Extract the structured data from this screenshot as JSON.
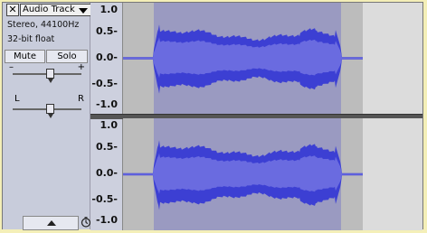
{
  "track": {
    "name": "Audio Track",
    "format": "Stereo, 44100Hz",
    "bitdepth": "32-bit float",
    "mute_label": "Mute",
    "solo_label": "Solo",
    "gain_minus": "–",
    "gain_plus": "+",
    "pan_left": "L",
    "pan_right": "R",
    "gain_level": 0.55,
    "pan_level": 0.55
  },
  "ruler": {
    "top": [
      "1.0",
      "0.5-",
      "0.0-",
      "-0.5-",
      "-1.0"
    ],
    "bottom": [
      "1.0",
      "0.5-",
      "0.0-",
      "-0.5-",
      "-1.0"
    ]
  },
  "colors": {
    "selection": "#9a9ac1",
    "background": "#bcbcbc",
    "wave_outer": "#3c3fd3",
    "wave_inner": "#6a6be0",
    "bright": "#dcdcdc"
  }
}
